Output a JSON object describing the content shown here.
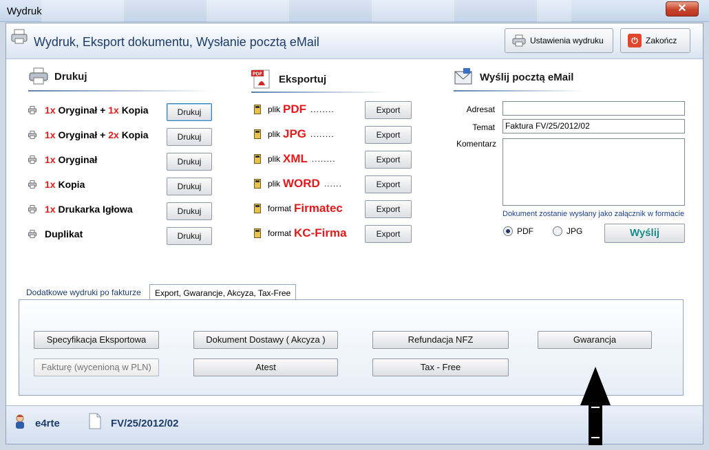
{
  "window": {
    "title": "Wydruk",
    "close_glyph": "✕"
  },
  "header": {
    "title": "Wydruk,  Eksport dokumentu,  Wysłanie pocztą eMail",
    "settings_button": "Ustawienia wydruku",
    "close_button": "Zakończ",
    "close_icon_glyph": "⏻"
  },
  "print": {
    "heading": "Drukuj",
    "rows": [
      {
        "parts": [
          {
            "t": "1x ",
            "red": true
          },
          {
            "t": "Oryginał + ",
            "red": false
          },
          {
            "t": "1x ",
            "red": true
          },
          {
            "t": "Kopia",
            "red": false
          }
        ],
        "button": "Drukuj"
      },
      {
        "parts": [
          {
            "t": "1x ",
            "red": true
          },
          {
            "t": "Oryginał + ",
            "red": false
          },
          {
            "t": "2x ",
            "red": true
          },
          {
            "t": "Kopia",
            "red": false
          }
        ],
        "button": "Drukuj"
      },
      {
        "parts": [
          {
            "t": "1x ",
            "red": true
          },
          {
            "t": "Oryginał",
            "red": false
          }
        ],
        "button": "Drukuj"
      },
      {
        "parts": [
          {
            "t": "1x ",
            "red": true
          },
          {
            "t": "Kopia",
            "red": false
          }
        ],
        "button": "Drukuj"
      },
      {
        "parts": [
          {
            "t": "1x ",
            "red": true
          },
          {
            "t": "Drukarka Igłowa",
            "red": false
          }
        ],
        "button": "Drukuj"
      },
      {
        "parts": [
          {
            "t": "Duplikat",
            "red": false
          }
        ],
        "button": "Drukuj"
      }
    ]
  },
  "export": {
    "heading": "Eksportuj",
    "rows": [
      {
        "prefix": "plik",
        "format": "PDF",
        "dots": "........",
        "button": "Export"
      },
      {
        "prefix": "plik",
        "format": "JPG",
        "dots": "........",
        "button": "Export"
      },
      {
        "prefix": "plik",
        "format": "XML",
        "dots": "........",
        "button": "Export"
      },
      {
        "prefix": "plik",
        "format": "WORD",
        "dots": "......",
        "button": "Export"
      },
      {
        "prefix": "format",
        "format": "Firmatec",
        "dots": "",
        "button": "Export"
      },
      {
        "prefix": "format",
        "format": "KC-Firma",
        "dots": "",
        "button": "Export"
      }
    ]
  },
  "email": {
    "heading": "Wyślij pocztą eMail",
    "address_label": "Adresat",
    "address_value": "",
    "subject_label": "Temat",
    "subject_value": "Faktura FV/25/2012/02",
    "comment_label": "Komentarz",
    "comment_value": "",
    "info": "Dokument zostanie wysłany jako załącznik w formacie",
    "format_options": [
      {
        "label": "PDF",
        "selected": true
      },
      {
        "label": "JPG",
        "selected": false
      }
    ],
    "send_button": "Wyślij"
  },
  "tabs": {
    "items": [
      {
        "label": "Dodatkowe wydruki po fakturze",
        "active": false
      },
      {
        "label": "Export, Gwarancje, Akcyza, Tax-Free",
        "active": true
      }
    ],
    "panel_buttons": [
      {
        "label": "Specyfikacja Eksportowa",
        "enabled": true
      },
      {
        "label": "Dokument Dostawy ( Akcyza )",
        "enabled": true
      },
      {
        "label": "Refundacja NFZ",
        "enabled": true
      },
      {
        "label": "Gwarancja",
        "enabled": true
      },
      {
        "label": "Fakturę (wycenioną w PLN)",
        "enabled": false
      },
      {
        "label": "Atest",
        "enabled": true
      },
      {
        "label": "Tax - Free",
        "enabled": true
      }
    ]
  },
  "footer": {
    "user": "e4rte",
    "document": "FV/25/2012/02"
  },
  "colors": {
    "accent": "#1d3c6b",
    "highlight_red": "#e01b1b",
    "send_text": "#198a8a"
  },
  "icons": [
    "printer-icon",
    "pdf-icon",
    "mail-icon",
    "user-icon",
    "document-icon",
    "power-icon",
    "close-icon",
    "arrow-up-icon"
  ]
}
